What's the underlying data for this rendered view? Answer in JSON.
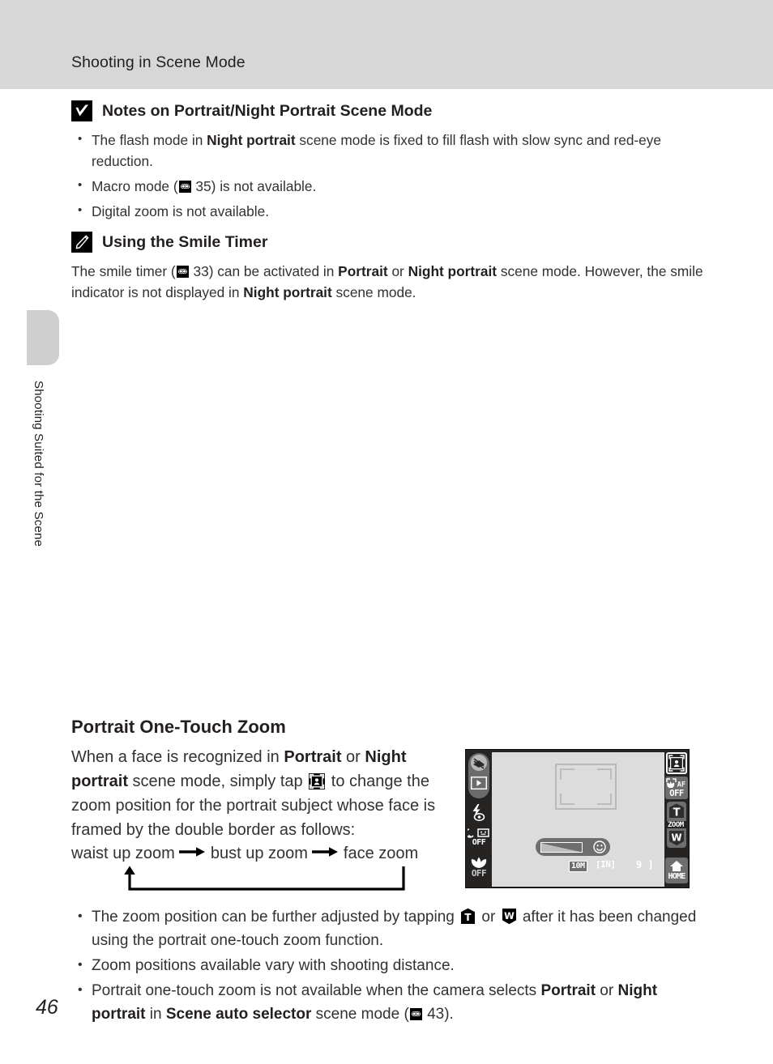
{
  "header": {
    "title": "Shooting in Scene Mode"
  },
  "side_tab": {
    "label": "Shooting Suited for the Scene"
  },
  "notes": [
    {
      "icon": "caution-checkmark-icon",
      "title": "Notes on Portrait/Night Portrait Scene Mode",
      "bullets": [
        {
          "parts": [
            {
              "t": "The flash mode in ",
              "b": false
            },
            {
              "t": "Night portrait",
              "b": true
            },
            {
              "t": " scene mode is fixed to fill flash with slow sync and red-eye reduction.",
              "b": false
            }
          ]
        },
        {
          "parts": [
            {
              "t": "Macro mode (",
              "b": false
            },
            {
              "t": "REF",
              "b": false,
              "ref": true
            },
            {
              "t": " 35) is not available.",
              "b": false
            }
          ]
        },
        {
          "parts": [
            {
              "t": "Digital zoom is not available.",
              "b": false
            }
          ]
        }
      ]
    },
    {
      "icon": "pencil-note-icon",
      "title": "Using the Smile Timer",
      "paragraph": [
        {
          "t": "The smile timer (",
          "b": false
        },
        {
          "t": "REF",
          "b": false,
          "ref": true
        },
        {
          "t": " 33) can be activated in ",
          "b": false
        },
        {
          "t": "Portrait",
          "b": true
        },
        {
          "t": " or ",
          "b": false
        },
        {
          "t": "Night portrait",
          "b": true
        },
        {
          "t": " scene mode. However, the smile indicator is not displayed in ",
          "b": false
        },
        {
          "t": "Night portrait",
          "b": true
        },
        {
          "t": " scene mode.",
          "b": false
        }
      ]
    }
  ],
  "section": {
    "heading": "Portrait One-Touch Zoom",
    "body": [
      {
        "t": "When a face is recognized in ",
        "b": false
      },
      {
        "t": "Portrait",
        "b": true
      },
      {
        "t": " or ",
        "b": false
      },
      {
        "t": "Night portrait",
        "b": true
      },
      {
        "t": " scene mode, simply tap ",
        "b": false
      },
      {
        "t": "OTZ",
        "b": false,
        "otz": true
      },
      {
        "t": " to change the zoom position for the portrait subject whose face is framed by the double border as follows:",
        "b": false
      }
    ],
    "flow": {
      "step1": "waist up zoom",
      "step2": "bust up zoom",
      "step3": "face zoom",
      "arrow_icon": "right-arrow-icon",
      "loop_icon": "loop-back-arrow-icon"
    }
  },
  "lcd": {
    "left_icons": [
      {
        "name": "scene-mode-icon",
        "label": ""
      },
      {
        "name": "playback-mode-icon",
        "label": ""
      },
      {
        "name": "flash-red-eye-icon",
        "label": ""
      },
      {
        "name": "self-timer-off-icon",
        "label": "OFF"
      },
      {
        "name": "macro-mode-off-icon",
        "label": "OFF"
      }
    ],
    "right_icons": [
      {
        "name": "portrait-one-touch-zoom-icon",
        "label": "",
        "highlighted": true
      },
      {
        "name": "af-off-icon",
        "label": "OFF",
        "sublabel": "AF"
      },
      {
        "name": "zoom-tele-button",
        "label": "T"
      },
      {
        "name": "zoom-label",
        "label": "ZOOM"
      },
      {
        "name": "zoom-wide-button",
        "label": "W"
      },
      {
        "name": "home-button",
        "label": "HOME"
      }
    ],
    "status": {
      "image_size": "10M",
      "memory": "[IN]",
      "shots_remaining": "9 ]"
    },
    "smile_indicator_name": "smile-indicator-bar"
  },
  "footnotes": [
    [
      {
        "t": "The zoom position can be further adjusted by tapping ",
        "b": false
      },
      {
        "t": "T",
        "b": false,
        "tw": "T"
      },
      {
        "t": " or ",
        "b": false
      },
      {
        "t": "W",
        "b": false,
        "tw": "W"
      },
      {
        "t": " after it has been changed using the portrait one-touch zoom function.",
        "b": false
      }
    ],
    [
      {
        "t": "Zoom positions available vary with shooting distance.",
        "b": false
      }
    ],
    [
      {
        "t": "Portrait one-touch zoom is not available when the camera selects ",
        "b": false
      },
      {
        "t": "Portrait",
        "b": true
      },
      {
        "t": " or ",
        "b": false
      },
      {
        "t": "Night portrait",
        "b": true
      },
      {
        "t": " in ",
        "b": false
      },
      {
        "t": "Scene auto selector",
        "b": true
      },
      {
        "t": " scene mode (",
        "b": false
      },
      {
        "t": "REF",
        "b": false,
        "ref": true
      },
      {
        "t": " 43).",
        "b": false
      }
    ]
  ],
  "page_number": "46",
  "colors": {
    "header_band": "#d7d7d7",
    "side_tab": "#cfcfcf",
    "text": "#333132",
    "lcd_bezel": "#262323",
    "lcd_screen": "#dcdcdc"
  }
}
